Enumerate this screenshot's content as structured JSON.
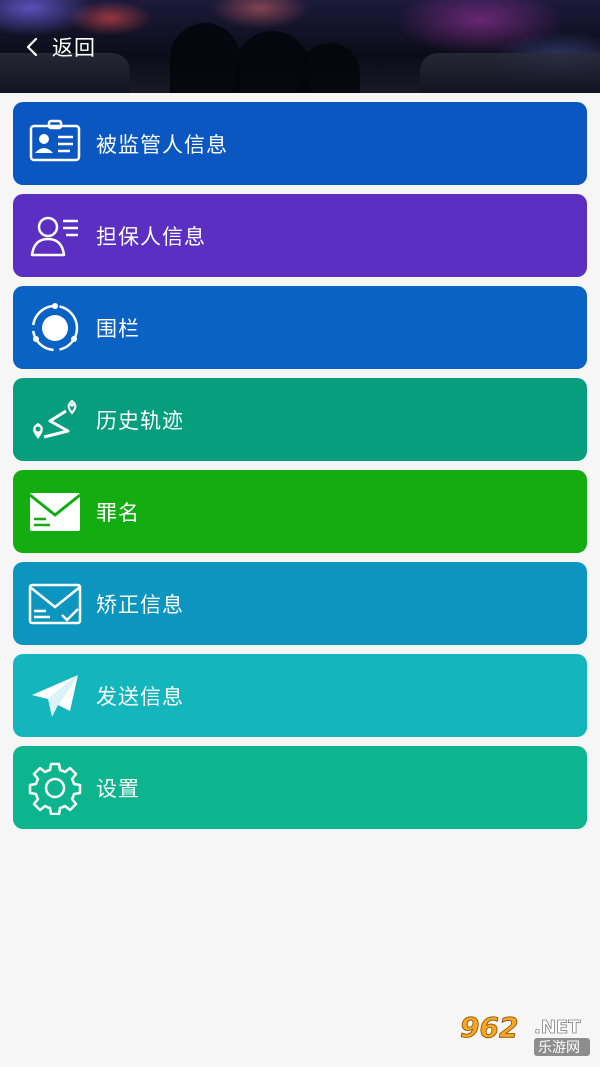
{
  "header": {
    "back_label": "返回"
  },
  "menu": {
    "items": [
      {
        "label": "被监管人信息",
        "icon": "id-card-icon",
        "color": "#0a57c2"
      },
      {
        "label": "担保人信息",
        "icon": "guarantor-person-icon",
        "color": "#5a2fc2"
      },
      {
        "label": "围栏",
        "icon": "fence-circle-icon",
        "color": "#0a62c4"
      },
      {
        "label": "历史轨迹",
        "icon": "track-route-icon",
        "color": "#079e7e"
      },
      {
        "label": "罪名",
        "icon": "envelope-icon",
        "color": "#13ad12"
      },
      {
        "label": "矫正信息",
        "icon": "correction-envelope-icon",
        "color": "#0c96bf"
      },
      {
        "label": "发送信息",
        "icon": "paper-plane-icon",
        "color": "#13b6bd"
      },
      {
        "label": "设置",
        "icon": "gear-icon",
        "color": "#0cb58e"
      }
    ]
  },
  "watermark": {
    "text_number": "962",
    "text_suffix": ".NET",
    "text_cn": "乐游网"
  }
}
